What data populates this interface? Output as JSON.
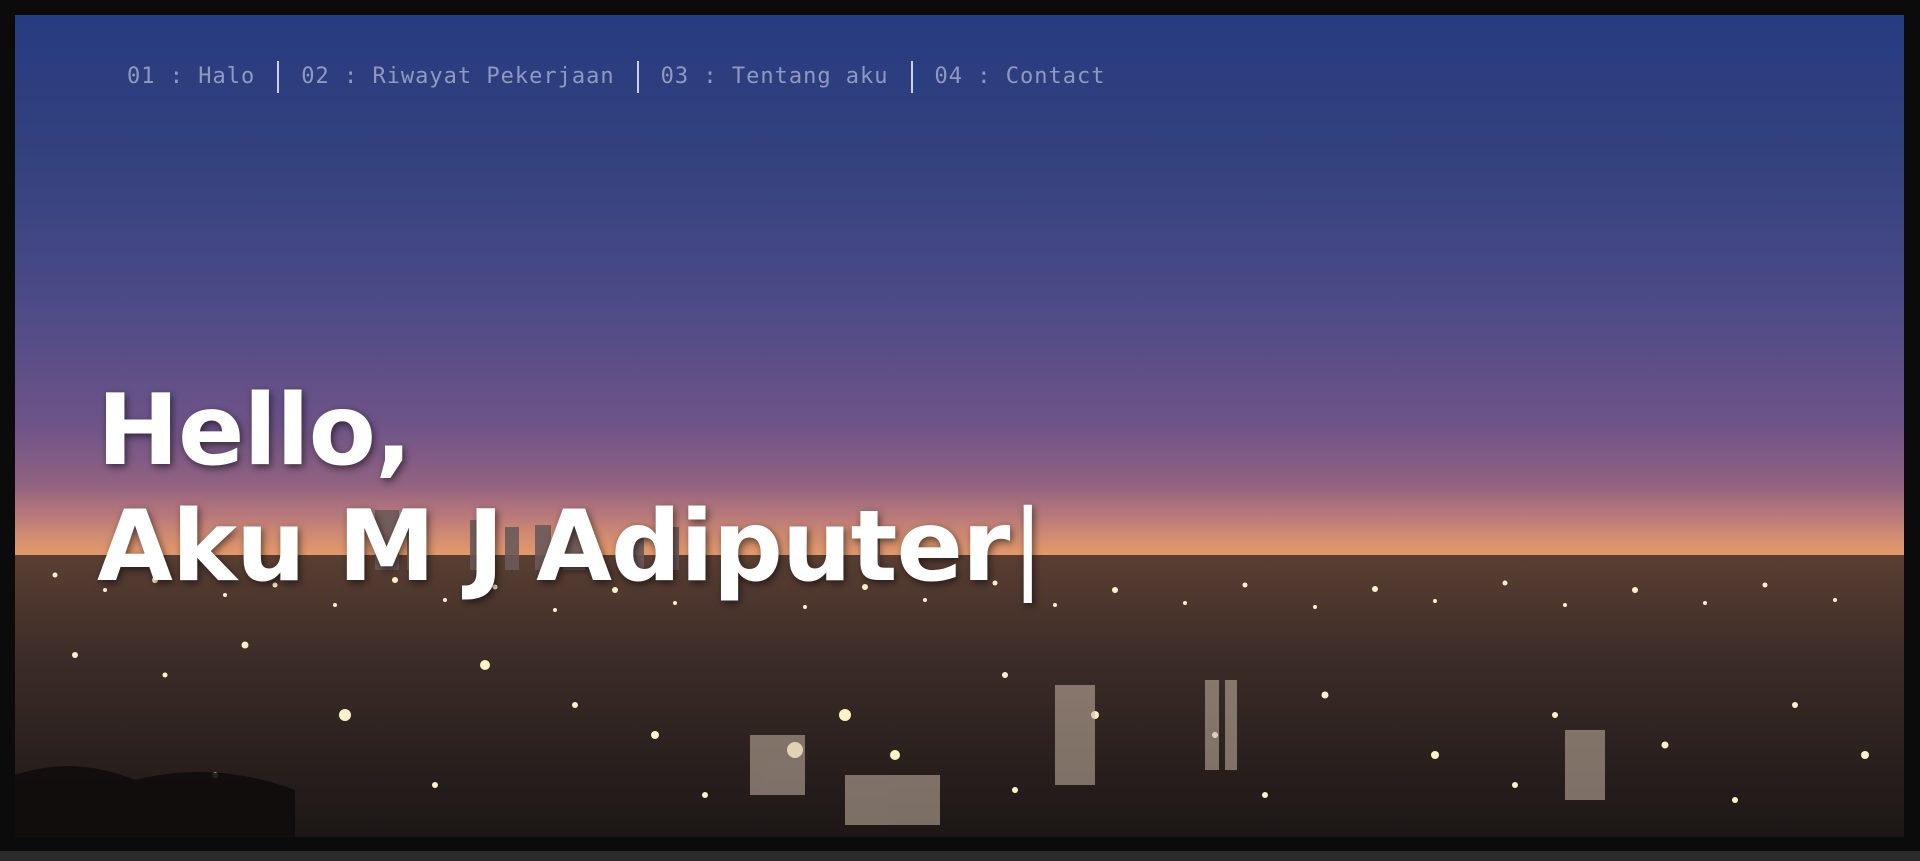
{
  "nav": {
    "items": [
      {
        "label": "01 : Halo"
      },
      {
        "label": "02 : Riwayat Pekerjaan"
      },
      {
        "label": "03 : Tentang aku"
      },
      {
        "label": "04 : Contact"
      }
    ]
  },
  "hero": {
    "greeting": "Hello,",
    "intro": "Aku M J Adiputer",
    "cursor": "|"
  },
  "colors": {
    "sky_top": "#273b80",
    "horizon_glow": "#e9a257",
    "headline_text": "#ffffff"
  }
}
